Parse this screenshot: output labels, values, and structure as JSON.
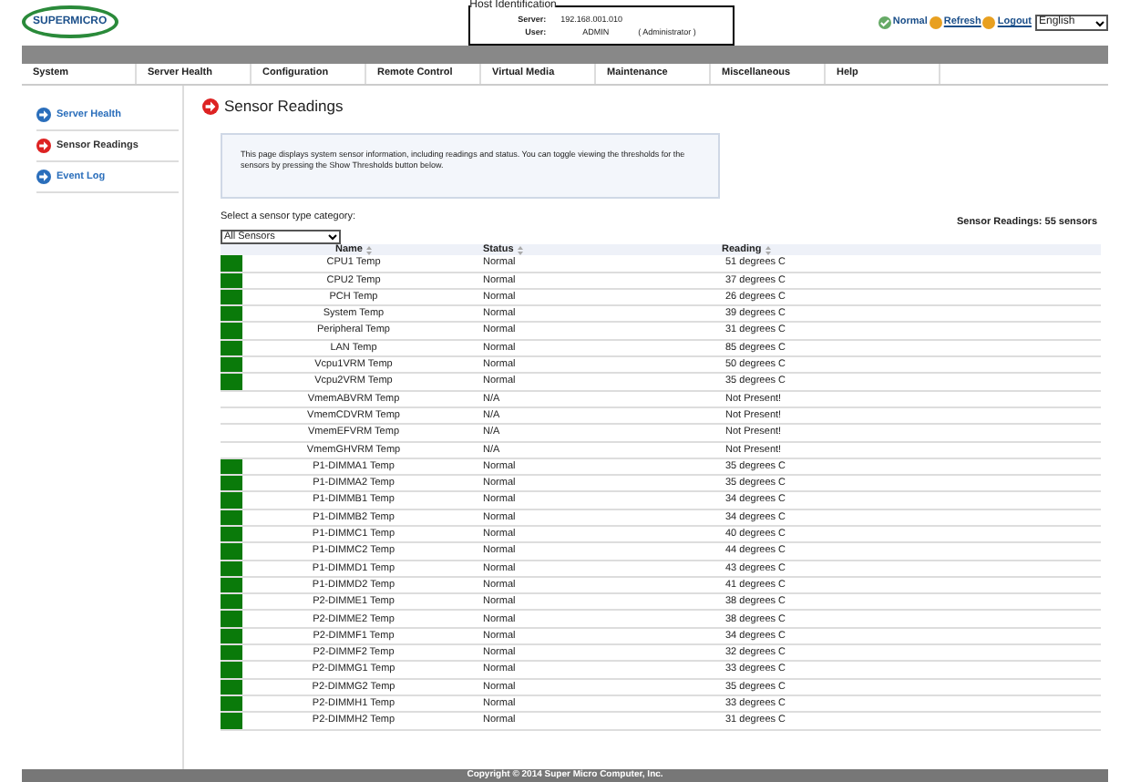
{
  "header": {
    "logo": "SUPERMICRO",
    "host_identification": {
      "title": "Host Identification",
      "server_label": "Server:",
      "server": "192.168.001.010",
      "user_label": "User:",
      "user": "ADMIN",
      "role": "( Administrator )"
    },
    "status": "Normal",
    "refresh": "Refresh",
    "logout": "Logout",
    "language": "English"
  },
  "menu": [
    {
      "label": "System"
    },
    {
      "label": "Server Health"
    },
    {
      "label": "Configuration"
    },
    {
      "label": "Remote Control"
    },
    {
      "label": "Virtual Media"
    },
    {
      "label": "Maintenance"
    },
    {
      "label": "Miscellaneous"
    },
    {
      "label": "Help"
    }
  ],
  "sidebar": {
    "items": [
      {
        "label": "Server Health",
        "selected": false
      },
      {
        "label": "Sensor Readings",
        "selected": true
      },
      {
        "label": "Event Log",
        "selected": false
      }
    ]
  },
  "page_title": "Sensor Readings",
  "info": "This page displays system sensor information, including readings and status. You can toggle viewing the thresholds for the sensors by pressing the Show Thresholds button below.",
  "category_label": "Select a sensor type category:",
  "category": "All Sensors",
  "sensor_count": "Sensor Readings: 55 sensors",
  "table": {
    "columns": [
      "Name",
      "Status",
      "Reading"
    ],
    "rows": [
      {
        "present": true,
        "name": "CPU1 Temp",
        "status": "Normal",
        "reading": "51 degrees C"
      },
      {
        "present": true,
        "name": "CPU2 Temp",
        "status": "Normal",
        "reading": "37 degrees C"
      },
      {
        "present": true,
        "name": "PCH Temp",
        "status": "Normal",
        "reading": "26 degrees C"
      },
      {
        "present": true,
        "name": "System Temp",
        "status": "Normal",
        "reading": "39 degrees C"
      },
      {
        "present": true,
        "name": "Peripheral Temp",
        "status": "Normal",
        "reading": "31 degrees C"
      },
      {
        "present": true,
        "name": "LAN Temp",
        "status": "Normal",
        "reading": "85 degrees C"
      },
      {
        "present": true,
        "name": "Vcpu1VRM Temp",
        "status": "Normal",
        "reading": "50 degrees C"
      },
      {
        "present": true,
        "name": "Vcpu2VRM Temp",
        "status": "Normal",
        "reading": "35 degrees C"
      },
      {
        "present": false,
        "name": "VmemABVRM Temp",
        "status": "N/A",
        "reading": "Not Present!"
      },
      {
        "present": false,
        "name": "VmemCDVRM Temp",
        "status": "N/A",
        "reading": "Not Present!"
      },
      {
        "present": false,
        "name": "VmemEFVRM Temp",
        "status": "N/A",
        "reading": "Not Present!"
      },
      {
        "present": false,
        "name": "VmemGHVRM Temp",
        "status": "N/A",
        "reading": "Not Present!"
      },
      {
        "present": true,
        "name": "P1-DIMMA1 Temp",
        "status": "Normal",
        "reading": "35 degrees C"
      },
      {
        "present": true,
        "name": "P1-DIMMA2 Temp",
        "status": "Normal",
        "reading": "35 degrees C"
      },
      {
        "present": true,
        "name": "P1-DIMMB1 Temp",
        "status": "Normal",
        "reading": "34 degrees C"
      },
      {
        "present": true,
        "name": "P1-DIMMB2 Temp",
        "status": "Normal",
        "reading": "34 degrees C"
      },
      {
        "present": true,
        "name": "P1-DIMMC1 Temp",
        "status": "Normal",
        "reading": "40 degrees C"
      },
      {
        "present": true,
        "name": "P1-DIMMC2 Temp",
        "status": "Normal",
        "reading": "44 degrees C"
      },
      {
        "present": true,
        "name": "P1-DIMMD1 Temp",
        "status": "Normal",
        "reading": "43 degrees C"
      },
      {
        "present": true,
        "name": "P1-DIMMD2 Temp",
        "status": "Normal",
        "reading": "41 degrees C"
      },
      {
        "present": true,
        "name": "P2-DIMME1 Temp",
        "status": "Normal",
        "reading": "38 degrees C"
      },
      {
        "present": true,
        "name": "P2-DIMME2 Temp",
        "status": "Normal",
        "reading": "38 degrees C"
      },
      {
        "present": true,
        "name": "P2-DIMMF1 Temp",
        "status": "Normal",
        "reading": "34 degrees C"
      },
      {
        "present": true,
        "name": "P2-DIMMF2 Temp",
        "status": "Normal",
        "reading": "32 degrees C"
      },
      {
        "present": true,
        "name": "P2-DIMMG1 Temp",
        "status": "Normal",
        "reading": "33 degrees C"
      },
      {
        "present": true,
        "name": "P2-DIMMG2 Temp",
        "status": "Normal",
        "reading": "35 degrees C"
      },
      {
        "present": true,
        "name": "P2-DIMMH1 Temp",
        "status": "Normal",
        "reading": "33 degrees C"
      },
      {
        "present": true,
        "name": "P2-DIMMH2 Temp",
        "status": "Normal",
        "reading": "31 degrees C"
      }
    ]
  },
  "footer": "Copyright © 2014 Super Micro Computer, Inc."
}
